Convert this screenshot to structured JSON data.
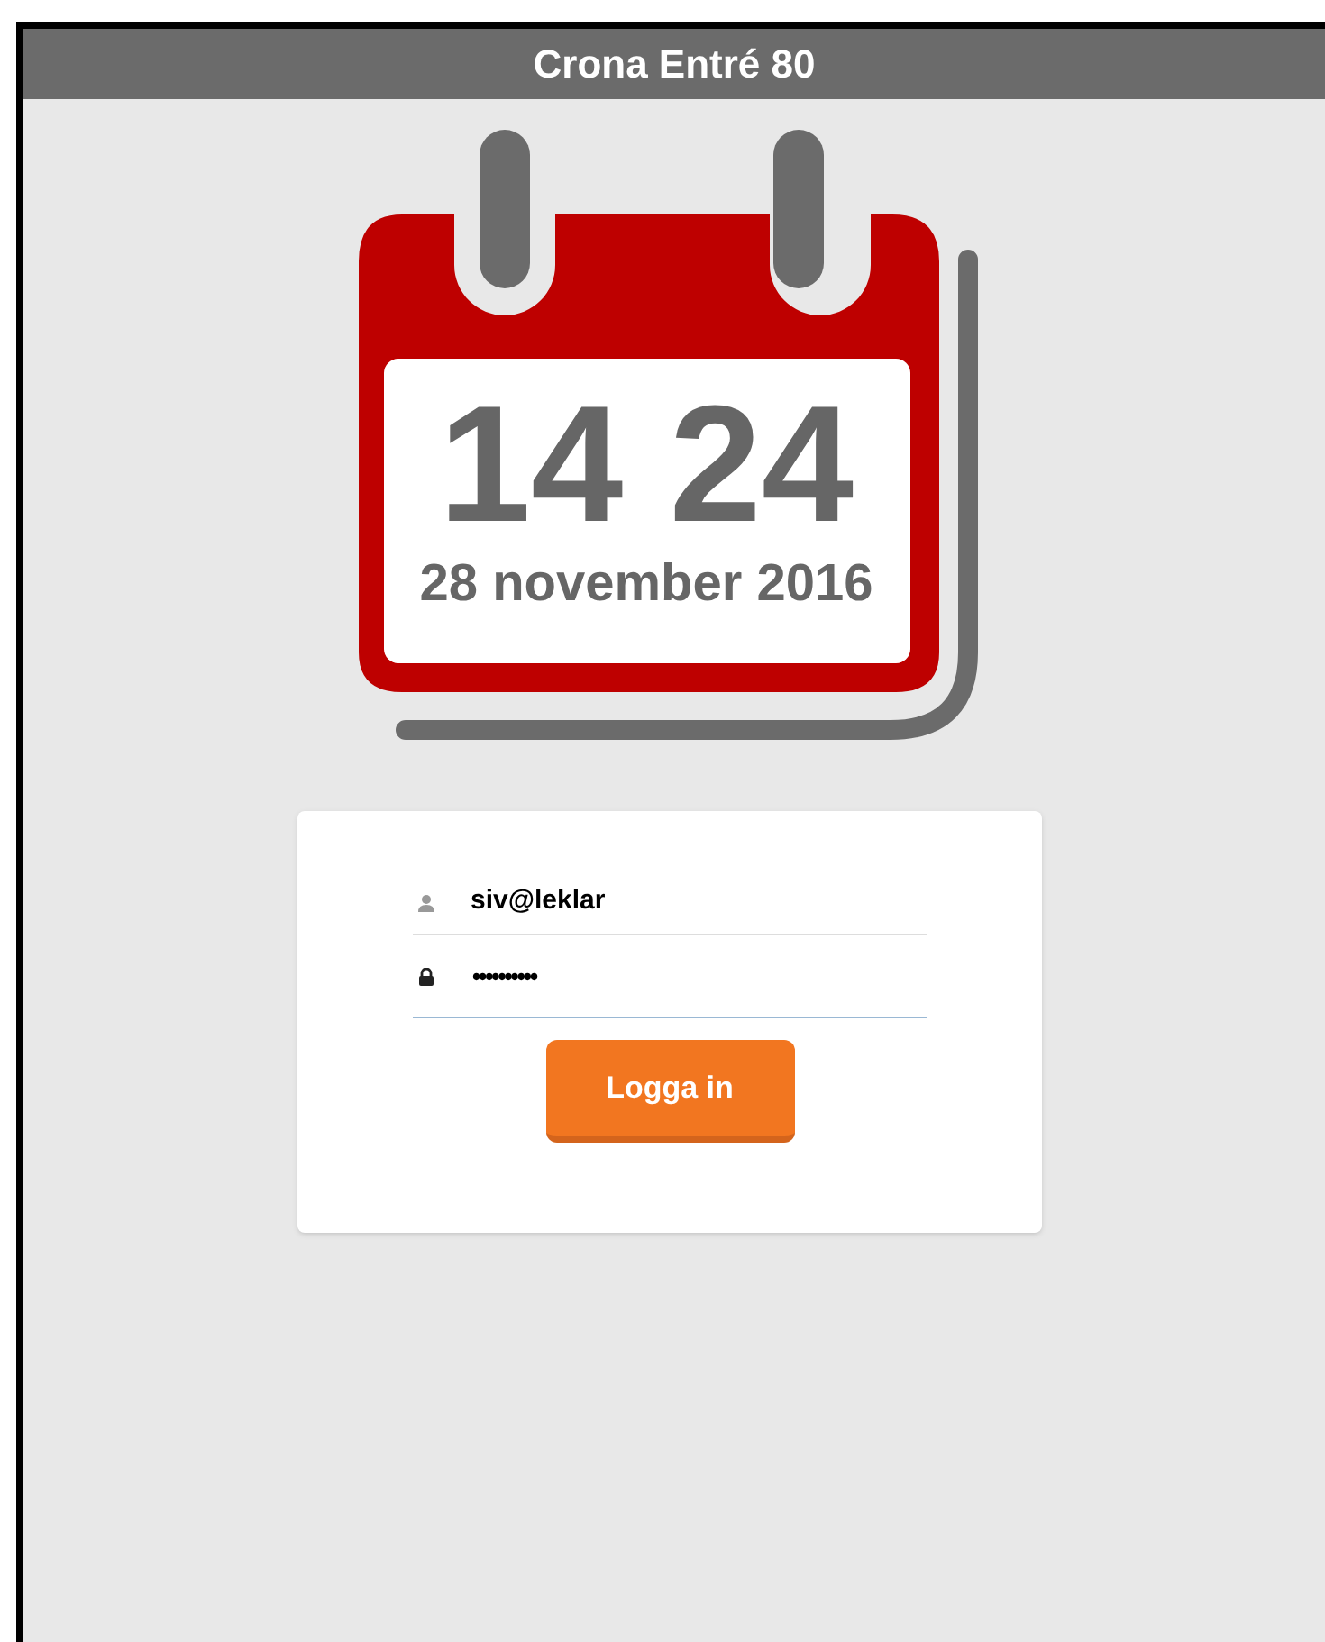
{
  "title_bar": {
    "title": "Crona Entré 80"
  },
  "clock": {
    "time": "14 24",
    "date": "28 november 2016"
  },
  "login": {
    "username": {
      "value": "siv@leklar"
    },
    "password": {
      "value": "••••••••••",
      "focused": true
    },
    "button": "Logga in"
  }
}
